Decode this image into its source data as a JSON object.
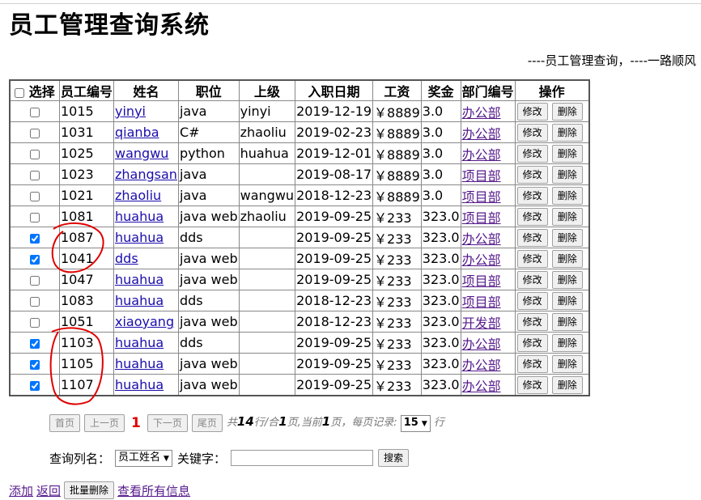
{
  "title": "员工管理查询系统",
  "subtitle": "----员工管理查询，----一路顺风",
  "table": {
    "headers": [
      "选择",
      "员工编号",
      "姓名",
      "职位",
      "上级",
      "入职日期",
      "工资",
      "奖金",
      "部门编号",
      "操作"
    ],
    "rows": [
      {
        "checked": false,
        "id": "1015",
        "name": "yinyi",
        "job": "java",
        "mgr": "yinyi",
        "date": "2019-12-19",
        "salary": "￥8889",
        "bonus": "3.0",
        "dept": "办公部"
      },
      {
        "checked": false,
        "id": "1031",
        "name": "qianba",
        "job": "C#",
        "mgr": "zhaoliu",
        "date": "2019-02-23",
        "salary": "￥8889",
        "bonus": "3.0",
        "dept": "办公部"
      },
      {
        "checked": false,
        "id": "1025",
        "name": "wangwu",
        "job": "python",
        "mgr": "huahua",
        "date": "2019-12-01",
        "salary": "￥8889",
        "bonus": "3.0",
        "dept": "办公部"
      },
      {
        "checked": false,
        "id": "1023",
        "name": "zhangsan",
        "job": "java",
        "mgr": "",
        "date": "2019-08-17",
        "salary": "￥8889",
        "bonus": "3.0",
        "dept": "项目部"
      },
      {
        "checked": false,
        "id": "1021",
        "name": "zhaoliu",
        "job": "java",
        "mgr": "wangwu",
        "date": "2018-12-23",
        "salary": "￥8889",
        "bonus": "3.0",
        "dept": "项目部"
      },
      {
        "checked": false,
        "id": "1081",
        "name": "huahua",
        "job": "java web",
        "mgr": "zhaoliu",
        "date": "2019-09-25",
        "salary": "￥233",
        "bonus": "323.0",
        "dept": "项目部"
      },
      {
        "checked": true,
        "id": "1087",
        "name": "huahua",
        "job": "dds",
        "mgr": "",
        "date": "2019-09-25",
        "salary": "￥233",
        "bonus": "323.0",
        "dept": "办公部"
      },
      {
        "checked": true,
        "id": "1041",
        "name": "dds",
        "job": "java web",
        "mgr": "",
        "date": "2019-09-25",
        "salary": "￥233",
        "bonus": "323.0",
        "dept": "办公部"
      },
      {
        "checked": false,
        "id": "1047",
        "name": "huahua",
        "job": "java web",
        "mgr": "",
        "date": "2019-09-25",
        "salary": "￥233",
        "bonus": "323.0",
        "dept": "项目部"
      },
      {
        "checked": false,
        "id": "1083",
        "name": "huahua",
        "job": "dds",
        "mgr": "",
        "date": "2018-12-23",
        "salary": "￥233",
        "bonus": "323.0",
        "dept": "项目部"
      },
      {
        "checked": false,
        "id": "1051",
        "name": "xiaoyang",
        "job": "java web",
        "mgr": "",
        "date": "2018-12-23",
        "salary": "￥233",
        "bonus": "323.0",
        "dept": "开发部"
      },
      {
        "checked": true,
        "id": "1103",
        "name": "huahua",
        "job": "dds",
        "mgr": "",
        "date": "2019-09-25",
        "salary": "￥233",
        "bonus": "323.0",
        "dept": "办公部"
      },
      {
        "checked": true,
        "id": "1105",
        "name": "huahua",
        "job": "java web",
        "mgr": "",
        "date": "2019-09-25",
        "salary": "￥233",
        "bonus": "323.0",
        "dept": "办公部"
      },
      {
        "checked": true,
        "id": "1107",
        "name": "huahua",
        "job": "java web",
        "mgr": "",
        "date": "2019-09-25",
        "salary": "￥233",
        "bonus": "323.0",
        "dept": "办公部"
      }
    ],
    "edit_label": "修改",
    "delete_label": "删除"
  },
  "pager": {
    "first": "首页",
    "prev": "上一页",
    "current": "1",
    "next": "下一页",
    "last": "尾页",
    "info_prefix": "共",
    "total_rows": "14",
    "info_rows_suffix": "行/合",
    "total_pages": "1",
    "info_pages_suffix": "页,当前",
    "current_page": "1",
    "info_page_suffix": "页，每页记录:",
    "per_page": "15",
    "rows_unit": "行"
  },
  "search": {
    "column_label": "查询列名：",
    "column_value": "员工姓名",
    "keyword_label": "关键字：",
    "keyword_value": "",
    "search_button": "搜索"
  },
  "footer": {
    "add": "添加",
    "back": "返回",
    "batch_delete": "批量删除",
    "view_all": "查看所有信息"
  },
  "colors": {
    "current_page": "#e00000",
    "annotation": "#e00000",
    "link": "#1a0dab",
    "visited_link": "#551a8b"
  }
}
